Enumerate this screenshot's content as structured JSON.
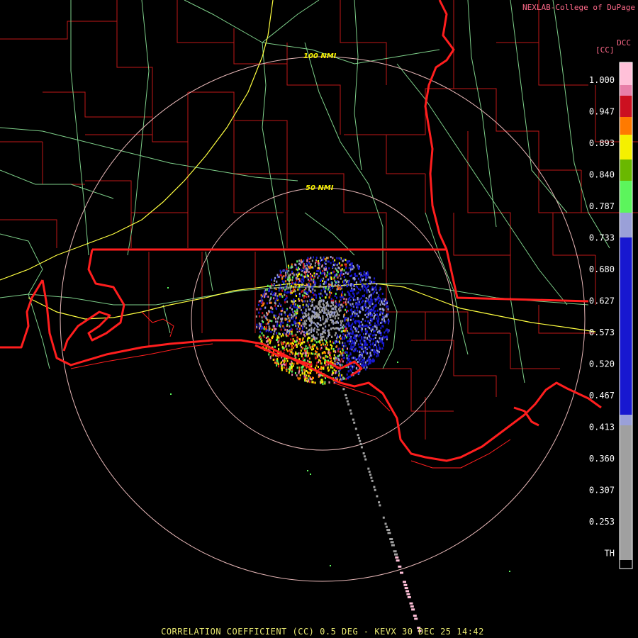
{
  "header": {
    "credit": "NEXLAB-College of DuPage",
    "product_code": "DCC",
    "unit": "[CC]"
  },
  "footer": {
    "title": "CORRELATION COEFFICIENT (CC) 0.5 DEG - KEVX 30 DEC 25 14:42"
  },
  "range_rings": [
    {
      "label": "50 NMI"
    },
    {
      "label": "100 NMI"
    }
  ],
  "legend": {
    "labels": [
      "1.000",
      "0.947",
      "0.893",
      "0.840",
      "0.787",
      "0.733",
      "0.680",
      "0.627",
      "0.573",
      "0.520",
      "0.467",
      "0.413",
      "0.360",
      "0.307",
      "0.253",
      "TH"
    ],
    "colors": {
      "pink_light": "#ffc0d8",
      "pink": "#e87fa8",
      "red": "#cc1020",
      "orange": "#ff7a00",
      "yellow": "#f5f000",
      "green_dark": "#6ab800",
      "green": "#5cf55c",
      "lavender": "#9aa0d8",
      "blue": "#1818d0",
      "gray": "#a0a0a0",
      "th": "#000000"
    }
  },
  "map_colors": {
    "state_border": "#ff1e1e",
    "county": "#c01818",
    "highway": "#7ed08a",
    "interstate": "#ffff40",
    "ring": "#e8b8b8"
  }
}
